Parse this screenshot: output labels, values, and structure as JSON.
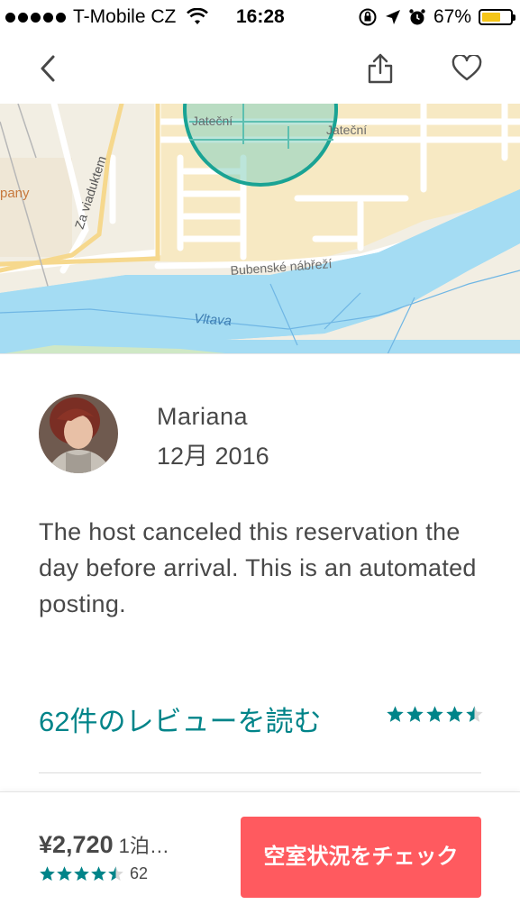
{
  "status_bar": {
    "carrier": "T-Mobile CZ",
    "time": "16:28",
    "battery_percent": "67%",
    "battery_level": 0.67,
    "battery_color": "#f5c518"
  },
  "nav": {
    "back_icon": "chevron-left-icon",
    "share_icon": "share-icon",
    "favorite_icon": "heart-icon"
  },
  "map": {
    "labels": {
      "street_1": "Jateční",
      "street_2": "Jateční",
      "street_3": "Za viaduktem",
      "street_4": "Bubenské nábřeží",
      "river": "Vltava",
      "edge_label": "pany"
    },
    "colors": {
      "land": "#f2eee3",
      "water": "#a4dcf3",
      "block": "#f7e9c3",
      "circle": "#1aa394"
    }
  },
  "review": {
    "name": "Mariana",
    "date": "12月 2016",
    "text": "The host canceled this reservation the day before arrival. This is an automated posting."
  },
  "reviews_link": {
    "label": "62件のレビューを読む",
    "rating": 4.5
  },
  "booking": {
    "price": "¥2,720",
    "per_night": "1泊…",
    "rating": 4.5,
    "review_count": "62",
    "button_label": "空室状況をチェック",
    "accent_color": "#ff5a5f",
    "star_color": "#008489"
  }
}
